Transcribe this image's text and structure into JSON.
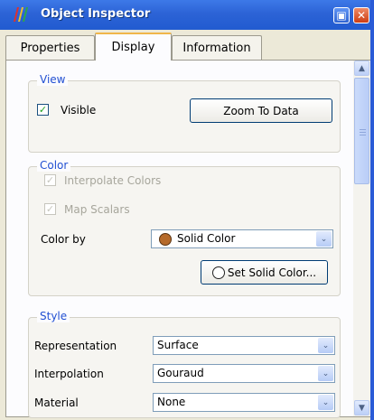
{
  "window": {
    "title": "Object Inspector",
    "float_glyph": "▣",
    "close_glyph": "✕",
    "icon": "paraview-logo-icon"
  },
  "tabs": [
    {
      "label": "Properties"
    },
    {
      "label": "Display"
    },
    {
      "label": "Information"
    }
  ],
  "active_tab": "Display",
  "view": {
    "group_label": "View",
    "visible_label": "Visible",
    "visible_checked": true,
    "zoom_button": "Zoom To Data"
  },
  "color": {
    "group_label": "Color",
    "interpolate_label": "Interpolate Colors",
    "map_scalars_label": "Map Scalars",
    "color_by_label": "Color by",
    "color_by_value": "Solid Color",
    "solid_swatch": "#b56a2b",
    "set_solid_button": "Set Solid Color..."
  },
  "style": {
    "group_label": "Style",
    "representation_label": "Representation",
    "representation_value": "Surface",
    "interpolation_label": "Interpolation",
    "interpolation_value": "Gouraud",
    "material_label": "Material",
    "material_value": "None"
  },
  "glyphs": {
    "check": "✓",
    "up": "▲",
    "down": "▼",
    "combo_arrow": "⌄"
  },
  "colors": {
    "title_bar": "#2c63d6",
    "group_label": "#2250d2",
    "active_tab_accent": "#f0b64a"
  }
}
